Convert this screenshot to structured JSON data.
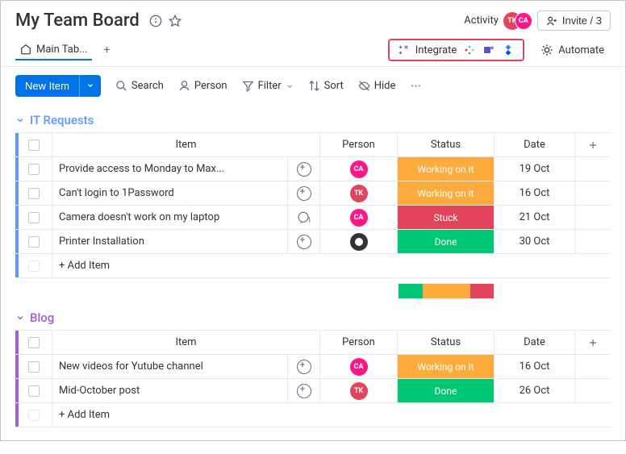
{
  "header": {
    "title": "My Team Board",
    "activity_label": "Activity",
    "invite_label": "Invite / 3"
  },
  "tabs": {
    "main_label": "Main Tab...",
    "integrate_label": "Integrate",
    "automate_label": "Automate"
  },
  "toolbar": {
    "new_item_label": "New Item",
    "search_label": "Search",
    "person_label": "Person",
    "filter_label": "Filter",
    "sort_label": "Sort",
    "hide_label": "Hide"
  },
  "columns": {
    "item": "Item",
    "person": "Person",
    "status": "Status",
    "date": "Date"
  },
  "groups": [
    {
      "id": "it",
      "name": "IT Requests",
      "color": "#579bfc",
      "rows": [
        {
          "item": "Provide access to Monday to Max...",
          "person": "CA",
          "person_type": "ca",
          "status": "Working on it",
          "status_class": "working",
          "date": "19 Oct"
        },
        {
          "item": "Can't login to 1Password",
          "person": "TK",
          "person_type": "tk",
          "status": "Working on it",
          "status_class": "working",
          "date": "16 Oct"
        },
        {
          "item": "Camera doesn't work on my laptop",
          "person": "CA",
          "person_type": "ca",
          "status": "Stuck",
          "status_class": "stuck",
          "date": "21 Oct",
          "chat_badge": "1"
        },
        {
          "item": "Printer Installation",
          "person": "",
          "person_type": "default",
          "status": "Done",
          "status_class": "done",
          "date": "30 Oct"
        }
      ],
      "add_item_label": "+ Add Item",
      "summary": [
        {
          "color": "#00c875",
          "flex": 1
        },
        {
          "color": "#fdab3d",
          "flex": 2
        },
        {
          "color": "#e2445c",
          "flex": 1
        }
      ]
    },
    {
      "id": "blog",
      "name": "Blog",
      "color": "#a25ddc",
      "rows": [
        {
          "item": "New videos for Yutube channel",
          "person": "CA",
          "person_type": "ca",
          "status": "Working on it",
          "status_class": "working",
          "date": "16 Oct"
        },
        {
          "item": "Mid-October post",
          "person": "TK",
          "person_type": "tk",
          "status": "Done",
          "status_class": "done",
          "date": "26 Oct"
        }
      ],
      "add_item_label": "+ Add Item"
    }
  ]
}
